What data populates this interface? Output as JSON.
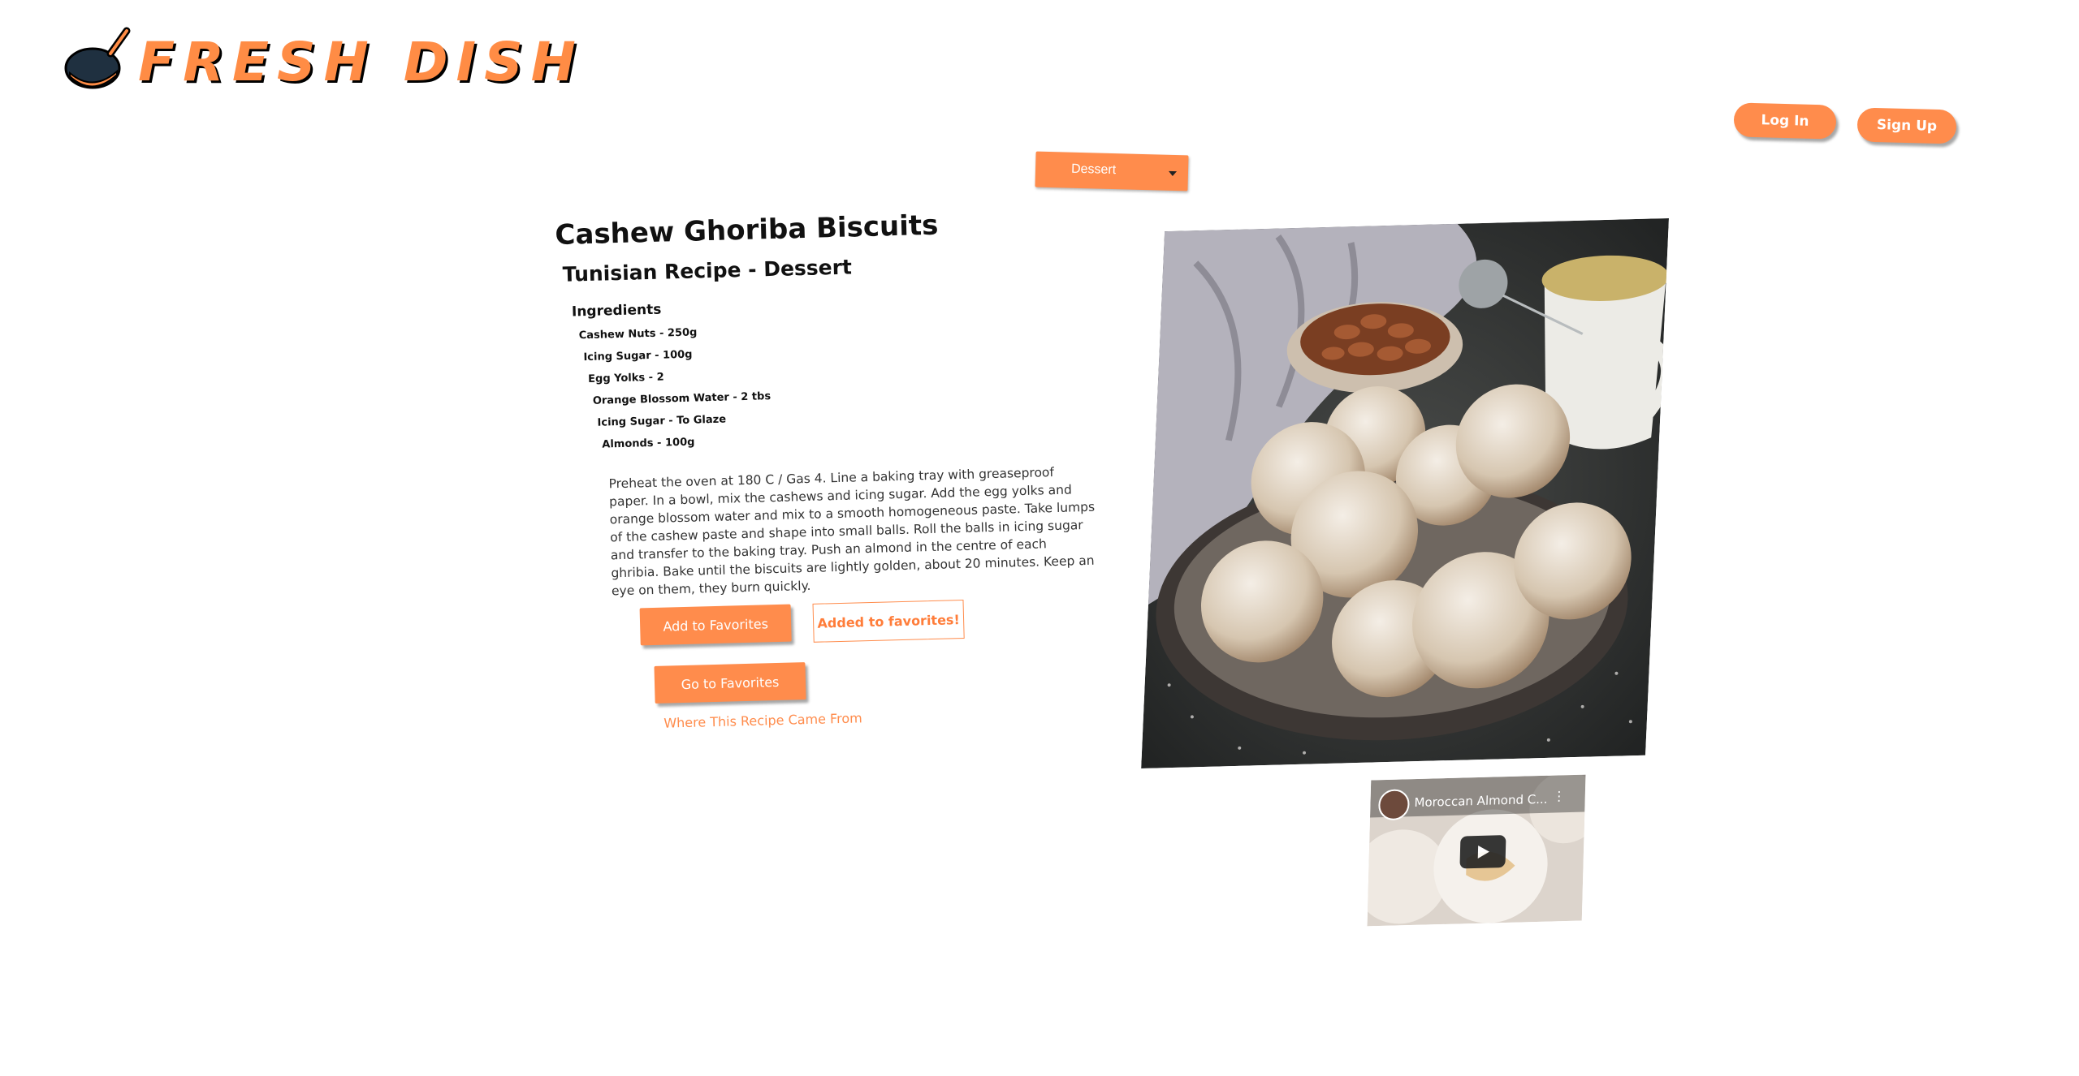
{
  "brand": {
    "name": "FRESH DISH"
  },
  "auth": {
    "login": "Log In",
    "signup": "Sign Up"
  },
  "category_select": {
    "selected": "Dessert"
  },
  "recipe": {
    "title": "Cashew Ghoriba Biscuits",
    "subtitle": "Tunisian Recipe - Dessert",
    "ingredients_heading": "Ingredients",
    "ingredients": [
      "Cashew Nuts - 250g",
      "Icing Sugar - 100g",
      "Egg Yolks - 2",
      "Orange Blossom Water - 2 tbs",
      "Icing Sugar - To Glaze",
      "Almonds - 100g"
    ],
    "instructions": "Preheat the oven at 180 C / Gas 4. Line a baking tray with greaseproof paper. In a bowl, mix the cashews and icing sugar. Add the egg yolks and orange blossom water and mix to a smooth homogeneous paste. Take lumps of the cashew paste and shape into small balls. Roll the balls in icing sugar and transfer to the baking tray. Push an almond in the centre of each ghribia. Bake until the biscuits are lightly golden, about 20 minutes. Keep an eye on them, they burn quickly.",
    "add_favorites": "Add to Favorites",
    "added_favorites": "Added to favorites!",
    "go_favorites": "Go to Favorites",
    "source_link": "Where This Recipe Came From"
  },
  "video": {
    "title": "Moroccan Almond C..."
  },
  "colors": {
    "accent": "#ff8c4c"
  }
}
